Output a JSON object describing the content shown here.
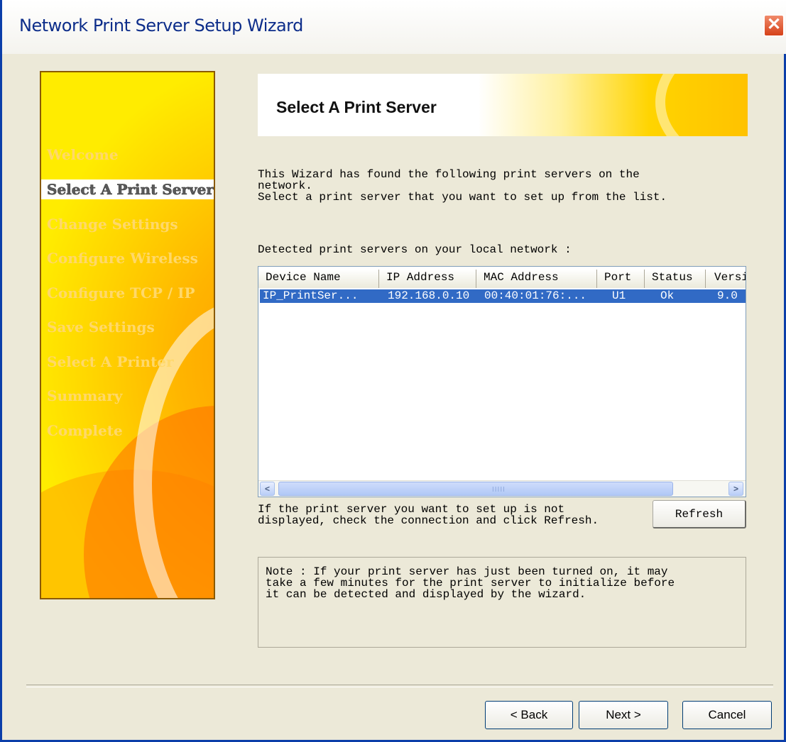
{
  "window": {
    "title": "Network Print Server Setup Wizard",
    "close_glyph": "✕"
  },
  "sidebar": {
    "items": [
      {
        "label": "Welcome",
        "selected": false
      },
      {
        "label": "Select A Print Server",
        "selected": true
      },
      {
        "label": "Change Settings",
        "selected": false
      },
      {
        "label": "Configure Wireless",
        "selected": false
      },
      {
        "label": "Configure TCP / IP",
        "selected": false
      },
      {
        "label": "Save Settings",
        "selected": false
      },
      {
        "label": "Select A Printer",
        "selected": false
      },
      {
        "label": "Summary",
        "selected": false
      },
      {
        "label": "Complete",
        "selected": false
      }
    ]
  },
  "header": {
    "title": "Select A Print Server"
  },
  "intro": {
    "text": "This Wizard has found the following print servers on the\nnetwork.\nSelect a print server that you want to set up from the list."
  },
  "detected_label": "Detected print servers on your local network :",
  "list": {
    "columns": [
      "Device Name",
      "IP Address",
      "MAC Address",
      "Port",
      "Status",
      "Version"
    ],
    "rows": [
      {
        "device_name": "IP_PrintSer...",
        "ip_address": "192.168.0.10",
        "mac_address": "00:40:01:76:...",
        "port": "U1",
        "status": "Ok",
        "version": "9.0"
      }
    ],
    "scroll_left_glyph": "<",
    "scroll_right_glyph": ">",
    "scroll_grip": "IIIII"
  },
  "hint": {
    "text": "If the print server you want to set up is not\ndisplayed, check the connection and click Refresh."
  },
  "refresh_button": "Refresh",
  "note": {
    "text": "Note : If your print server has just been turned on, it may\ntake a few minutes for the print server to initialize before\nit can be detected and displayed by the wizard."
  },
  "footer": {
    "back_label": "< Back",
    "next_label": "Next >",
    "cancel_label": "Cancel"
  },
  "colors": {
    "selection": "#316ac5",
    "window_bg": "#ece9d8",
    "title_text": "#0d2d8a"
  }
}
